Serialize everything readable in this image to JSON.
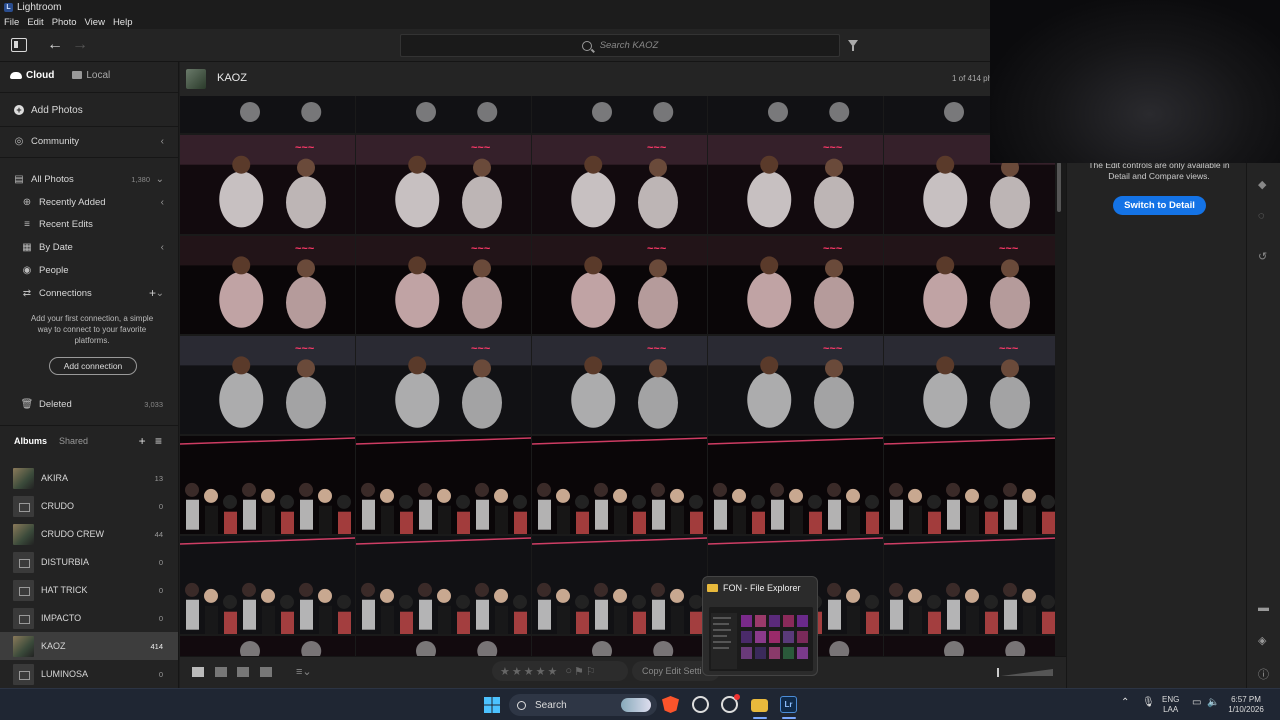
{
  "window": {
    "title": "Lightroom"
  },
  "menu": [
    "File",
    "Edit",
    "Photo",
    "View",
    "Help"
  ],
  "toolbar": {
    "search_placeholder": "Search KAOZ"
  },
  "sidebar": {
    "tabs": {
      "cloud": "Cloud",
      "local": "Local"
    },
    "add_photos": "Add Photos",
    "community": "Community",
    "all_photos": {
      "label": "All Photos",
      "count": "1,380"
    },
    "recently_added": "Recently Added",
    "recent_edits": "Recent Edits",
    "by_date": "By Date",
    "people": "People",
    "connections": "Connections",
    "connect_text": "Add your first connection, a simple way to connect to your favorite platforms.",
    "add_connection": "Add connection",
    "deleted": {
      "label": "Deleted",
      "count": "3,033"
    },
    "albums_tab": "Albums",
    "shared_tab": "Shared",
    "albums": [
      {
        "name": "AKIRA",
        "count": "13",
        "thumb": "photo"
      },
      {
        "name": "CRUDO",
        "count": "0",
        "thumb": "empty"
      },
      {
        "name": "CRUDO CREW",
        "count": "44",
        "thumb": "photo"
      },
      {
        "name": "DISTURBIA",
        "count": "0",
        "thumb": "empty"
      },
      {
        "name": "HAT TRICK",
        "count": "0",
        "thumb": "empty"
      },
      {
        "name": "IMPACTO",
        "count": "0",
        "thumb": "empty"
      },
      {
        "name": "KAOZ",
        "count": "414",
        "thumb": "photo",
        "selected": true
      },
      {
        "name": "LUMINOSA",
        "count": "0",
        "thumb": "empty"
      }
    ]
  },
  "main": {
    "album_title": "KAOZ",
    "photo_count": "1 of 414 ph",
    "copy_edit": "Copy Edit Setti"
  },
  "right_panel": {
    "info": "The Edit controls are only available in Detail and Compare views.",
    "switch_button": "Switch to Detail"
  },
  "taskbar": {
    "search_label": "Search",
    "lang_top": "ENG",
    "lang_bottom": "LAA",
    "time": "6:57 PM",
    "date": "1/10/2026",
    "explorer_popup_title": "FON - File Explorer"
  }
}
